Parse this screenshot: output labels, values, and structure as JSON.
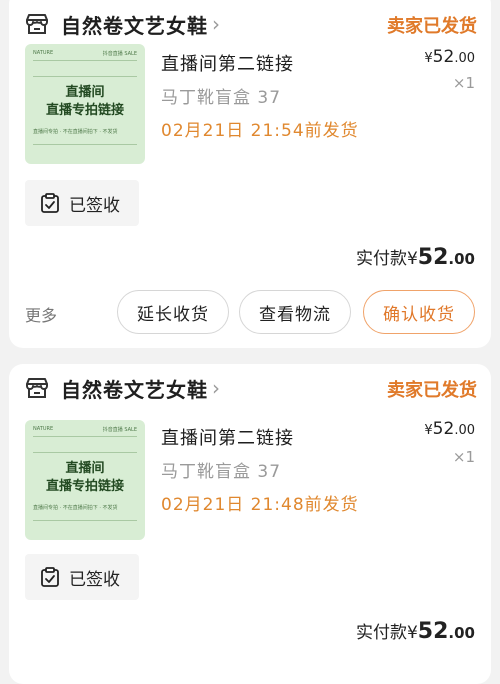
{
  "orders": [
    {
      "shop_name": "自然卷文艺女鞋",
      "status": "卖家已发货",
      "product": {
        "thumb": {
          "tag_left": "NATURE",
          "tag_right": "抖音直播 SALE",
          "line1": "直播间",
          "line2": "直播专拍链接",
          "footnote": "直播间专拍 · 不在直播间拍下 · 不发货"
        },
        "title": "直播间第二链接",
        "variant": "马丁靴盲盒 37",
        "ship_note": "02月21日 21:54前发货",
        "price_symbol": "¥",
        "price_int": "52",
        "price_dec": ".00",
        "qty": "×1"
      },
      "signed_label": "已签收",
      "paid_label": "实付款",
      "paid_symbol": "¥",
      "paid_int": "52",
      "paid_dec": ".00",
      "more_label": "更多",
      "actions": {
        "extend": "延长收货",
        "logistics": "查看物流",
        "confirm": "确认收货"
      }
    },
    {
      "shop_name": "自然卷文艺女鞋",
      "status": "卖家已发货",
      "product": {
        "thumb": {
          "tag_left": "NATURE",
          "tag_right": "抖音直播 SALE",
          "line1": "直播间",
          "line2": "直播专拍链接",
          "footnote": "直播间专拍 · 不在直播间拍下 · 不发货"
        },
        "title": "直播间第二链接",
        "variant": "马丁靴盲盒 37",
        "ship_note": "02月21日 21:48前发货",
        "price_symbol": "¥",
        "price_int": "52",
        "price_dec": ".00",
        "qty": "×1"
      },
      "signed_label": "已签收",
      "paid_label": "实付款",
      "paid_symbol": "¥",
      "paid_int": "52",
      "paid_dec": ".00"
    }
  ],
  "colors": {
    "accent": "#e07a2a",
    "ship_note": "#e0882f",
    "thumb_bg": "#d8edd4"
  }
}
